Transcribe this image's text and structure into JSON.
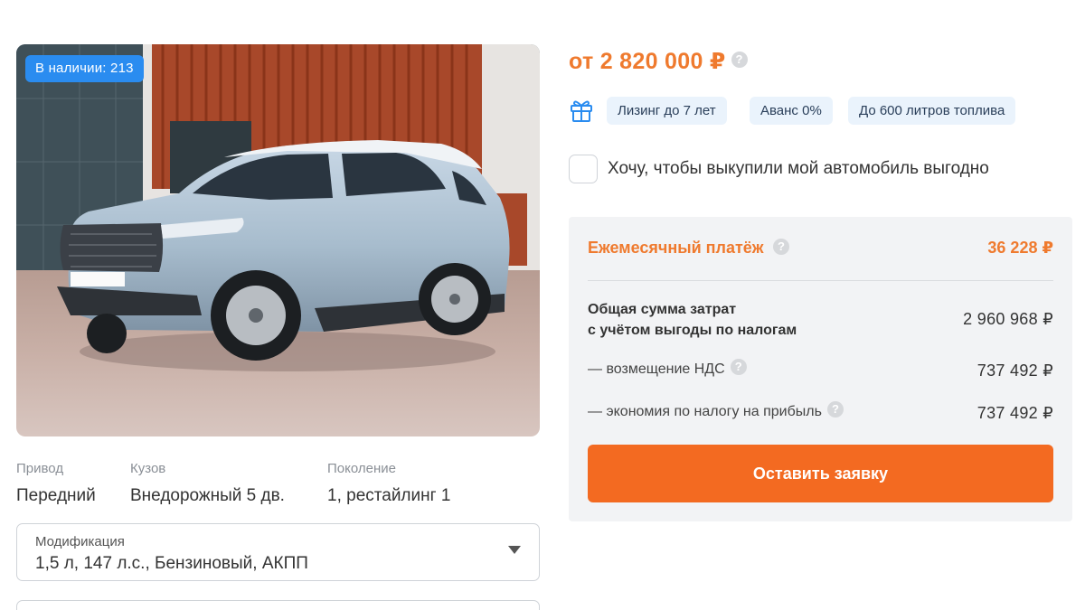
{
  "listing": {
    "stock_badge": "В наличии: 213",
    "photo_icon": "car-photo",
    "specs": [
      {
        "label": "Привод",
        "value": "Передний"
      },
      {
        "label": "Кузов",
        "value": "Внедорожный 5 дв."
      },
      {
        "label": "Поколение",
        "value": "1, рестайлинг 1"
      }
    ],
    "modification": {
      "label": "Модификация",
      "value": "1,5 л, 147 л.с., Бензиновый, АКПП"
    }
  },
  "offer": {
    "price": "от 2 820 000 ₽",
    "gift_icon": "gift-icon",
    "chips": [
      "Лизинг до 7 лет",
      "Аванс 0%",
      "До 600 литров топлива"
    ],
    "buyback_label": "Хочу, чтобы выкупили мой автомобиль выгодно",
    "buyback_checked": false
  },
  "calc": {
    "monthly_label": "Ежемесячный платёж",
    "monthly_value": "36 228 ₽",
    "total_label_1": "Общая сумма затрат",
    "total_label_2": "с учётом выгоды по налогам",
    "total_value": "2 960 968 ₽",
    "vat_label": "— возмещение НДС",
    "vat_value": "737 492 ₽",
    "profit_tax_label": "— экономия по налогу на прибыль",
    "profit_tax_value": "737 492 ₽",
    "cta_label": "Оставить заявку"
  },
  "colors": {
    "accent_orange": "#ef7a2e",
    "cta_orange": "#f36a21",
    "badge_blue": "#2a8cf0",
    "chip_bg": "#eaf3fc"
  }
}
